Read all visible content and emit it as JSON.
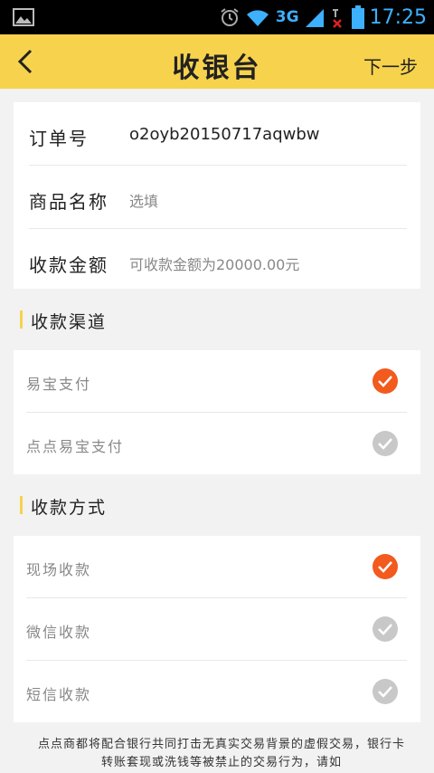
{
  "status_bar": {
    "network": "3G",
    "time": "17:25",
    "sim1": "1",
    "sim2": "2"
  },
  "header": {
    "title": "收银台",
    "next_label": "下一步"
  },
  "order_form": {
    "order_no_label": "订单号",
    "order_no_value": "o2oyb20150717aqwbw",
    "product_label": "商品名称",
    "product_placeholder": "选填",
    "amount_label": "收款金额",
    "amount_placeholder": "可收款金额为20000.00元"
  },
  "channel_section": {
    "title": "收款渠道",
    "options": [
      {
        "label": "易宝支付",
        "selected": true
      },
      {
        "label": "点点易宝支付",
        "selected": false
      }
    ]
  },
  "method_section": {
    "title": "收款方式",
    "options": [
      {
        "label": "现场收款",
        "selected": true
      },
      {
        "label": "微信收款",
        "selected": false
      },
      {
        "label": "短信收款",
        "selected": false
      }
    ]
  },
  "notice": "点点商都将配合银行共同打击无真实交易背景的虚假交易，银行卡转账套现或洗钱等被禁止的交易行为，请如",
  "colors": {
    "accent_yellow": "#f7d24d",
    "selected_orange": "#f25a1e",
    "unselected_gray": "#c8c8c8"
  }
}
